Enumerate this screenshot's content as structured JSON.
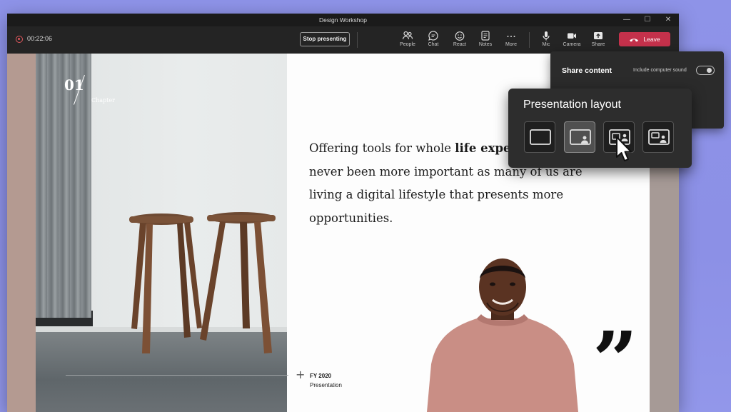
{
  "window": {
    "title": "Design Workshop",
    "controls": [
      "—",
      "☐",
      "✕"
    ]
  },
  "toolbar": {
    "timer": "00:22:06",
    "stop_presenting_label": "Stop presenting",
    "buttons": [
      {
        "label": "People",
        "icon": "people-icon"
      },
      {
        "label": "Chat",
        "icon": "chat-icon"
      },
      {
        "label": "React",
        "icon": "react-icon"
      },
      {
        "label": "Notes",
        "icon": "notes-icon"
      },
      {
        "label": "More",
        "icon": "more-icon"
      },
      {
        "label": "Mic",
        "icon": "mic-icon"
      },
      {
        "label": "Camera",
        "icon": "camera-icon"
      },
      {
        "label": "Share",
        "icon": "share-icon"
      }
    ],
    "leave_label": "Leave",
    "leave_color": "#c4314b"
  },
  "slide": {
    "chapter_number": "01",
    "chapter_label": "Chapter",
    "text_line1_normal": "Offering tools for whole ",
    "text_line1_bold": "life exper",
    "text_line2": "never been more important as many of us are",
    "text_line3": "living a digital lifestyle that presents more",
    "text_line4": "opportunities.",
    "footer_year": "FY 2020",
    "footer_label": "Presentation",
    "quote_mark": "”"
  },
  "share_panel": {
    "title": "Share content",
    "sound_label": "Include computer sound"
  },
  "layout_panel": {
    "title": "Presentation layout",
    "options": [
      "content-only-layout",
      "standout-layout",
      "side-by-side-layout",
      "reporter-layout"
    ]
  }
}
